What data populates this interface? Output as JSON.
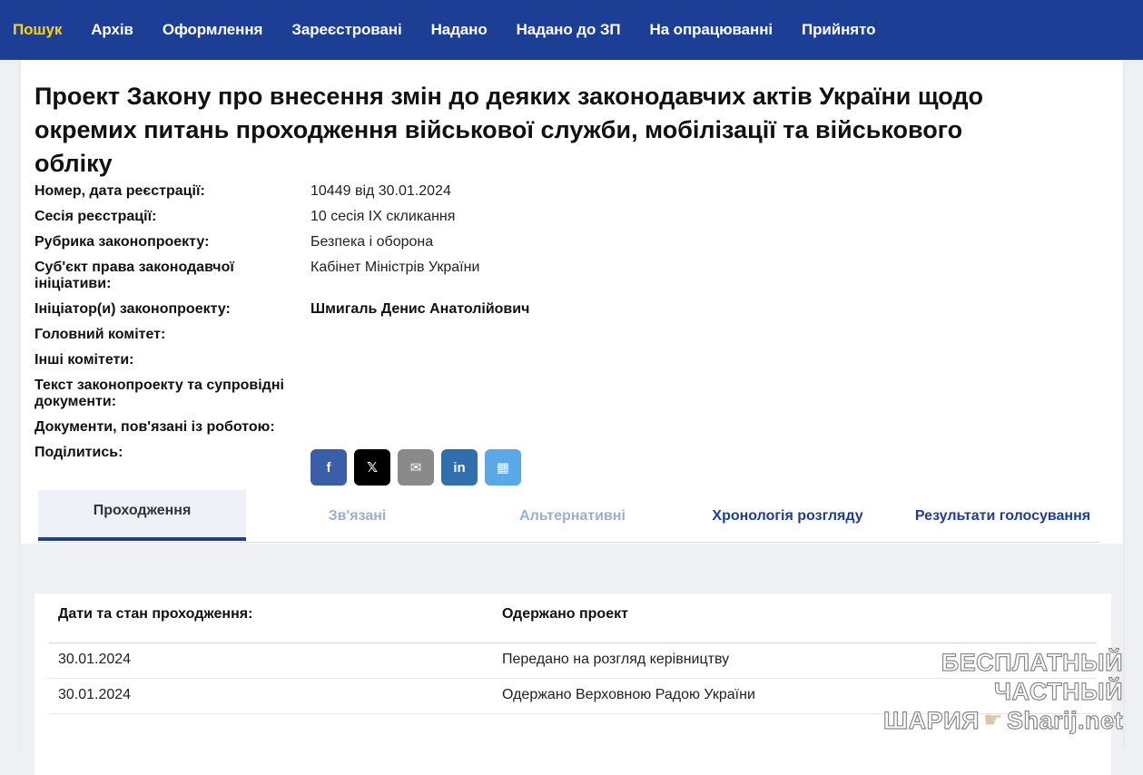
{
  "nav": {
    "items": [
      "Пошук",
      "Архів",
      "Оформлення",
      "Зареєстровані",
      "Надано",
      "Надано до ЗП",
      "На опрацюванні",
      "Прийнято"
    ],
    "active_index": 0,
    "active_color": "#ffd400",
    "background": "#1c3f95"
  },
  "bill": {
    "title": "Проект Закону про внесення змін до деяких законодавчих актів України щодо окремих питань проходження військової служби, мобілізації та військового обліку",
    "fields": [
      {
        "label": "Номер, дата реєстрації:",
        "value": "10449 від 30.01.2024"
      },
      {
        "label": "Сесія реєстрації:",
        "value": "10 сесія IX скликання"
      },
      {
        "label": "Рубрика законопроекту:",
        "value": "Безпека і оборона"
      },
      {
        "label": "Суб'єкт права законодавчої ініціативи:",
        "value": "Кабінет Міністрів України"
      },
      {
        "label": "Ініціатор(и) законопроекту:",
        "value": "Шмигаль Денис Анатолійович"
      },
      {
        "label": "Головний комітет:",
        "value": ""
      },
      {
        "label": "Інші комітети:",
        "value": ""
      },
      {
        "label": "Текст законопроекту та супровідні документи:",
        "value": ""
      },
      {
        "label": "Документи, пов'язані із роботою:",
        "value": ""
      }
    ],
    "share_label": "Поділитись:",
    "share_buttons": [
      {
        "icon": "facebook-icon",
        "glyph": "f"
      },
      {
        "icon": "x-twitter-icon",
        "glyph": "𝕏"
      },
      {
        "icon": "email-icon",
        "glyph": "✉"
      },
      {
        "icon": "linkedin-icon",
        "glyph": "in"
      },
      {
        "icon": "qr-code-icon",
        "glyph": "▦"
      }
    ]
  },
  "tabs": [
    "Проходження",
    "Зв'язані",
    "Альтернативні",
    "Хронологія розгляду",
    "Результати голосування"
  ],
  "progress_table": {
    "header": {
      "col1": "Дати та стан проходження:",
      "col2": "Одержано проект"
    },
    "rows": [
      {
        "date": "30.01.2024",
        "status": "Передано на розгляд керівництву"
      },
      {
        "date": "30.01.2024",
        "status": "Одержано Верховною Радою України"
      }
    ]
  },
  "watermark": {
    "line1": "БЕСПЛАТНЫЙ ЧАСТНЫЙ",
    "line2a": "ШАРИЯ",
    "line2b": "Sharij.net"
  }
}
